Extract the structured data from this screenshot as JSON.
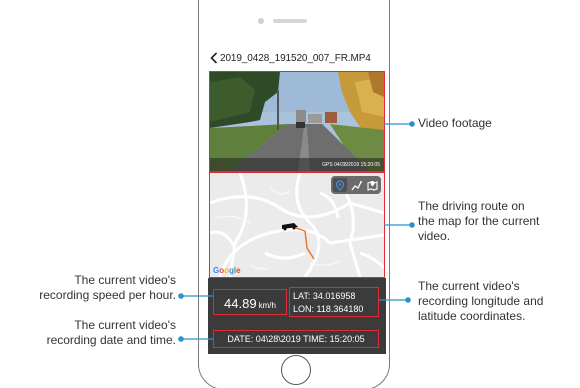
{
  "app": {
    "file_title": "2019_0428_191520_007_FR.MP4",
    "back_icon": "chevron-left-icon"
  },
  "video": {
    "gps_stamp": "GPS 04/28/2019 15:20:05"
  },
  "map": {
    "tools": [
      "location-pin-icon",
      "car-route-icon",
      "map-icon"
    ],
    "logo": "Google"
  },
  "info": {
    "speed_value": "44.89",
    "speed_unit": "km/h",
    "lat": "LAT: 34.016958",
    "lon": "LON: 118.364180",
    "date_time": "DATE: 04\\28\\2019 TIME: 15:20:05"
  },
  "annotations": {
    "video_footage": "Video footage",
    "route_line1": "The driving route on",
    "route_line2": "the map for the current",
    "route_line3": "video.",
    "speed_line1": "The current video's",
    "speed_line2": "recording speed per hour.",
    "coords_line1": "The current video's",
    "coords_line2": "recording longitude and",
    "coords_line3": "latitude coordinates.",
    "date_line1": "The current video's",
    "date_line2": "recording date and time."
  },
  "colors": {
    "highlight": "#e02a38",
    "leader": "#2f8fcf",
    "panel": "#3b3b3b"
  }
}
